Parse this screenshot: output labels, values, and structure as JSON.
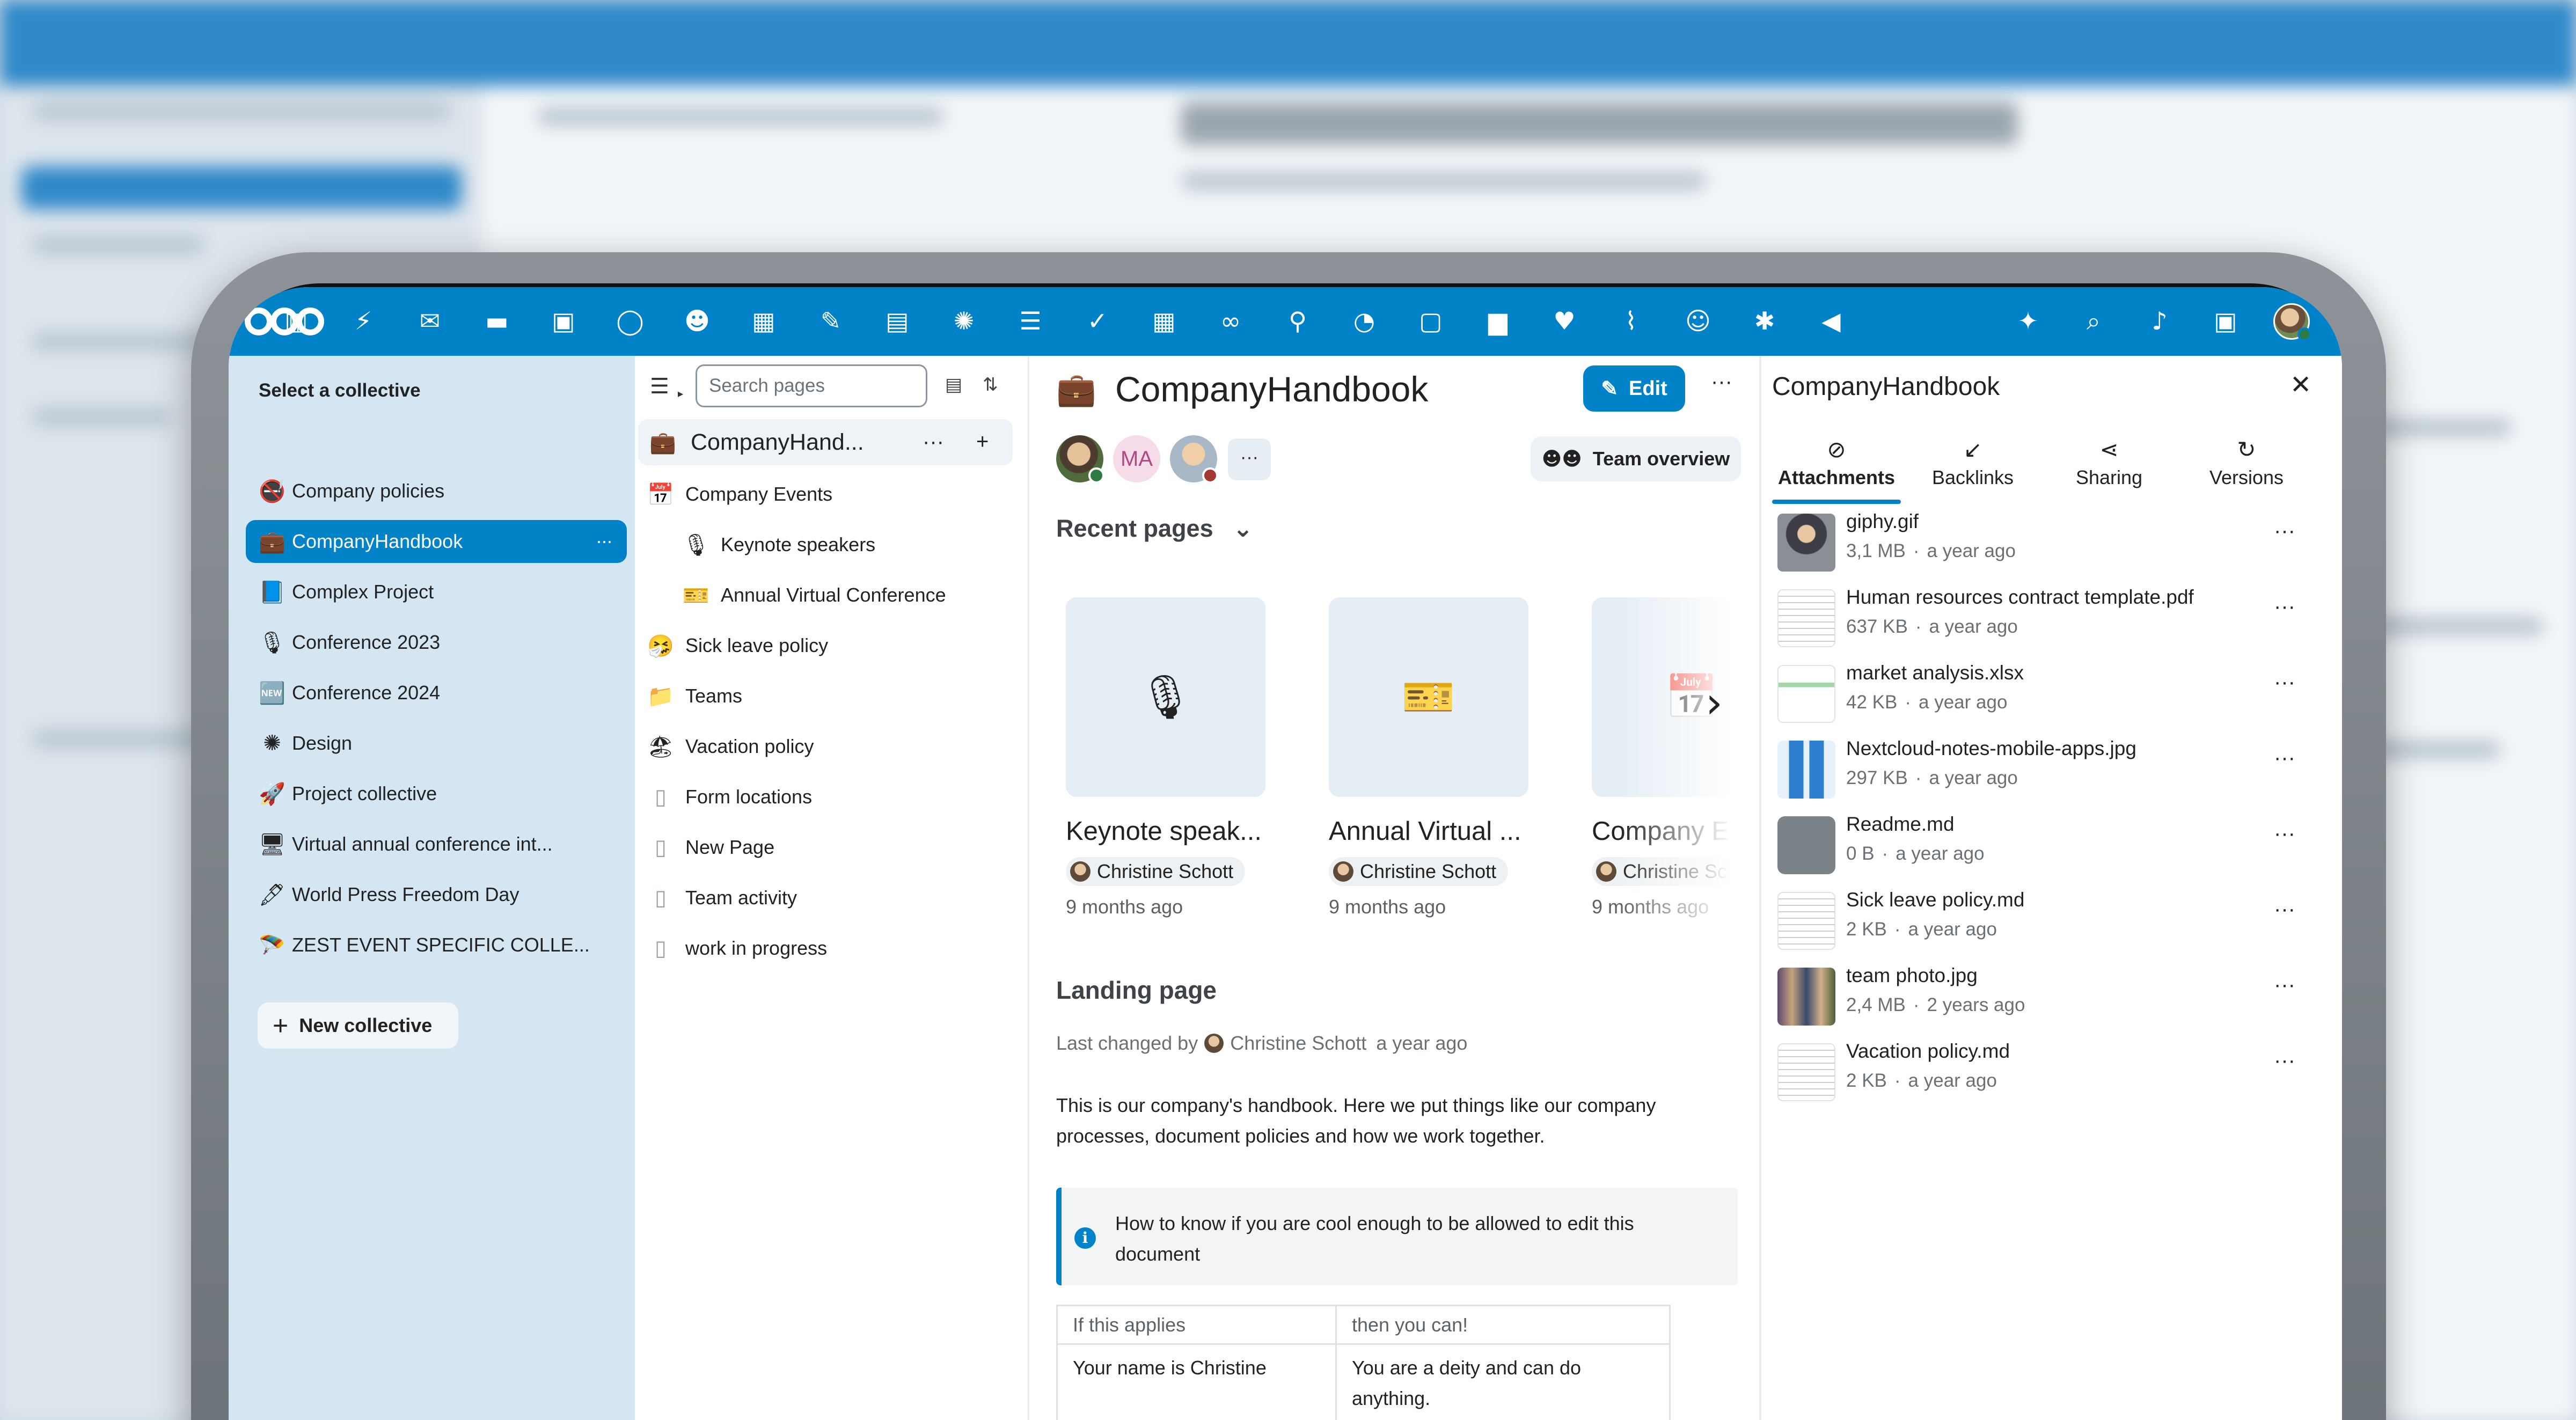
{
  "topbar": {
    "apps": [
      {
        "name": "dashboard-icon",
        "glyph": "▥"
      },
      {
        "name": "activity-icon",
        "glyph": "⚡"
      },
      {
        "name": "mail-icon",
        "glyph": "✉"
      },
      {
        "name": "files-icon",
        "glyph": "▬"
      },
      {
        "name": "photos-icon",
        "glyph": "▣"
      },
      {
        "name": "talk-icon",
        "glyph": "◯"
      },
      {
        "name": "contacts-icon",
        "glyph": "☻"
      },
      {
        "name": "calendar-icon",
        "glyph": "▦"
      },
      {
        "name": "notes-icon",
        "glyph": "✎"
      },
      {
        "name": "deck-icon",
        "glyph": "▤"
      },
      {
        "name": "collectives-icon",
        "glyph": "✺"
      },
      {
        "name": "tasks-list-icon",
        "glyph": "☰"
      },
      {
        "name": "tasks-check-icon",
        "glyph": "✓"
      },
      {
        "name": "tables-icon",
        "glyph": "▦"
      },
      {
        "name": "link-icon",
        "glyph": "∞"
      },
      {
        "name": "maps-icon",
        "glyph": "⚲"
      },
      {
        "name": "dashboard-gauge-icon",
        "glyph": "◔"
      },
      {
        "name": "bus-icon",
        "glyph": "▢"
      },
      {
        "name": "briefcase-icon",
        "glyph": "▆"
      },
      {
        "name": "heart-icon",
        "glyph": "♥"
      },
      {
        "name": "analytics-icon",
        "glyph": "⌇"
      },
      {
        "name": "user-icon",
        "glyph": "☺"
      },
      {
        "name": "announcements-icon",
        "glyph": "✱"
      },
      {
        "name": "megaphone-icon",
        "glyph": "◀"
      }
    ],
    "right": [
      {
        "name": "assistant-icon",
        "glyph": "✦"
      },
      {
        "name": "search-icon",
        "glyph": "⌕"
      },
      {
        "name": "notifications-icon",
        "glyph": "♪"
      },
      {
        "name": "contacts-menu-icon",
        "glyph": "▣"
      }
    ]
  },
  "nav1": {
    "title": "Select a collective",
    "items": [
      {
        "label": "Company policies",
        "icon": "🚭",
        "name": "company-policies-icon"
      },
      {
        "label": "CompanyHandbook",
        "icon": "💼",
        "name": "briefcase-icon",
        "active": true
      },
      {
        "label": "Complex Project",
        "icon": "📘",
        "name": "book-icon"
      },
      {
        "label": "Conference 2023",
        "icon": "🎙",
        "name": "microphone-icon"
      },
      {
        "label": "Conference 2024",
        "icon": "🆕",
        "name": "new-icon"
      },
      {
        "label": "Design",
        "icon": "✺",
        "name": "design-icon"
      },
      {
        "label": "Project collective",
        "icon": "🚀",
        "name": "rocket-icon"
      },
      {
        "label": "Virtual annual conference int...",
        "icon": "🖥",
        "name": "monitor-icon"
      },
      {
        "label": "World Press Freedom Day",
        "icon": "🖋",
        "name": "pen-icon"
      },
      {
        "label": "ZEST EVENT SPECIFIC COLLE...",
        "icon": "🪂",
        "name": "parachute-icon"
      }
    ],
    "more": "···",
    "new_collective": "New collective",
    "plus": "+"
  },
  "nav2": {
    "search_placeholder": "Search pages",
    "root": {
      "label": "CompanyHand...",
      "icon": "💼",
      "more": "···",
      "add": "+"
    },
    "items": [
      {
        "label": "Company Events",
        "icon": "📅",
        "name": "calendar-icon",
        "indent": 0,
        "caret": true
      },
      {
        "label": "Keynote speakers",
        "icon": "🎙",
        "name": "microphone-icon",
        "indent": 1
      },
      {
        "label": "Annual Virtual Conference",
        "icon": "🎫",
        "name": "ticket-icon",
        "indent": 1
      },
      {
        "label": "Sick leave policy",
        "icon": "🤧",
        "name": "sick-face-icon",
        "indent": 0
      },
      {
        "label": "Teams",
        "icon": "📁",
        "name": "folder-icon",
        "indent": 0
      },
      {
        "label": "Vacation policy",
        "icon": "🏖",
        "name": "beach-icon",
        "indent": 0
      },
      {
        "label": "Form locations",
        "icon": "▯",
        "name": "page-icon",
        "indent": 0
      },
      {
        "label": "New Page",
        "icon": "▯",
        "name": "page-icon",
        "indent": 0
      },
      {
        "label": "Team activity",
        "icon": "▯",
        "name": "page-icon",
        "indent": 0
      },
      {
        "label": "work in progress",
        "icon": "▯",
        "name": "page-icon",
        "indent": 0,
        "caret": true
      }
    ]
  },
  "main": {
    "icon": "💼",
    "title": "CompanyHandbook",
    "edit_label": "Edit",
    "edit_icon": "✎",
    "more": "···",
    "members": [
      {
        "type": "photo"
      },
      {
        "type": "initials",
        "text": "MA"
      },
      {
        "type": "photo"
      },
      {
        "type": "more",
        "text": "···"
      }
    ],
    "team_overview": "Team overview",
    "recent_title": "Recent pages",
    "recent_caret": "⌄",
    "cards": [
      {
        "title": "Keynote speak...",
        "author": "Christine Schott",
        "time": "9 months ago",
        "icon": "🎙"
      },
      {
        "title": "Annual Virtual ...",
        "author": "Christine Schott",
        "time": "9 months ago",
        "icon": "🎫"
      },
      {
        "title": "Company E",
        "author": "Christine Sc",
        "time": "9 months ago",
        "icon": "📅"
      }
    ],
    "next_arrow": "›",
    "landing_title": "Landing page",
    "last_changed_prefix": "Last changed by",
    "last_changed_author": "Christine Schott",
    "last_changed_time": "a year ago",
    "intro": "This is our company's handbook. Here we put things like our company processes, document policies and how we work together.",
    "callout": "How to know if you are cool enough to be allowed to edit this document",
    "callout_icon": "i",
    "table": {
      "rows": [
        [
          "If this applies",
          "then you can!"
        ],
        [
          "Your name is Christine",
          "You are a deity and can do anything."
        ]
      ]
    }
  },
  "sidebar": {
    "title": "CompanyHandbook",
    "close": "✕",
    "tabs": [
      {
        "label": "Attachments",
        "icon": "⊘",
        "name": "paperclip-icon",
        "active": true
      },
      {
        "label": "Backlinks",
        "icon": "↙",
        "name": "backlink-icon"
      },
      {
        "label": "Sharing",
        "icon": "⋖",
        "name": "share-icon"
      },
      {
        "label": "Versions",
        "icon": "↻",
        "name": "history-icon"
      }
    ],
    "attachments": [
      {
        "name": "giphy.gif",
        "size": "3,1 MB",
        "time": "a year ago",
        "thumb": "photo"
      },
      {
        "name": "Human resources contract template.pdf",
        "size": "637 KB",
        "time": "a year ago",
        "thumb": "doc"
      },
      {
        "name": "market analysis.xlsx",
        "size": "42 KB",
        "time": "a year ago",
        "thumb": "sheet"
      },
      {
        "name": "Nextcloud-notes-mobile-apps.jpg",
        "size": "297 KB",
        "time": "a year ago",
        "thumb": "blue"
      },
      {
        "name": "Readme.md",
        "size": "0 B",
        "time": "a year ago",
        "thumb": "text"
      },
      {
        "name": "Sick leave policy.md",
        "size": "2 KB",
        "time": "a year ago",
        "thumb": "doc"
      },
      {
        "name": "team photo.jpg",
        "size": "2,4 MB",
        "time": "2 years ago",
        "thumb": "group"
      },
      {
        "name": "Vacation policy.md",
        "size": "2 KB",
        "time": "a year ago",
        "thumb": "doc"
      }
    ],
    "separator": "·",
    "more": "···"
  },
  "colors": {
    "brand": "#0082c9",
    "nav_bg": "#d5e6f3"
  }
}
